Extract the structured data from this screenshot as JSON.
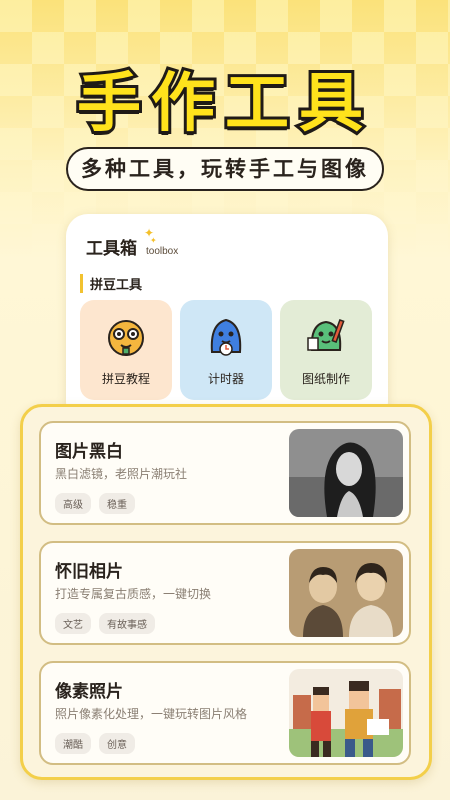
{
  "hero": {
    "title": "手作工具",
    "subtitle": "多种工具，玩转手工与图像"
  },
  "toolbox": {
    "title": "工具箱",
    "subtitle": "toolbox",
    "section_label": "拼豆工具",
    "tools": [
      {
        "label": "拼豆教程",
        "icon": "bean-tutorial-mascot-icon"
      },
      {
        "label": "计时器",
        "icon": "timer-mascot-icon"
      },
      {
        "label": "图纸制作",
        "icon": "pattern-maker-mascot-icon"
      }
    ]
  },
  "filters": [
    {
      "title": "图片黑白",
      "desc": "黑白滤镜，老照片潮玩社",
      "tags": [
        "高级",
        "稳重"
      ],
      "thumb": "bw-portrait-thumbnail"
    },
    {
      "title": "怀旧相片",
      "desc": "打造专属复古质感，一键切换",
      "tags": [
        "文艺",
        "有故事感"
      ],
      "thumb": "vintage-photo-thumbnail"
    },
    {
      "title": "像素照片",
      "desc": "照片像素化处理，一键玩转图片风格",
      "tags": [
        "潮酷",
        "创意"
      ],
      "thumb": "pixel-art-thumbnail"
    }
  ],
  "colors": {
    "accent_yellow": "#ffe21c",
    "border_gold": "#f3cf4a",
    "text_dark": "#2a231d"
  }
}
